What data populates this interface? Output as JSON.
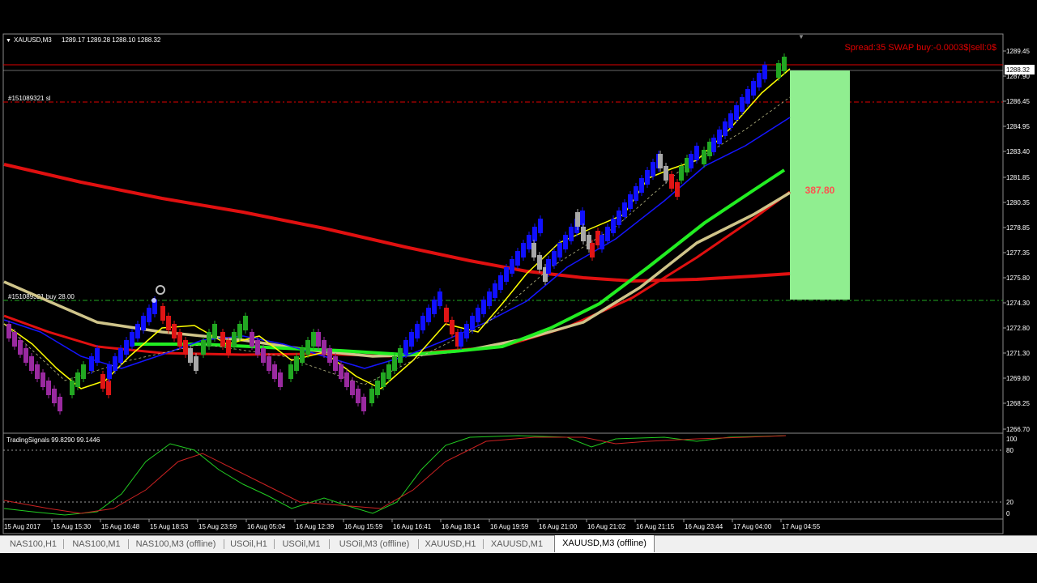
{
  "window": {
    "symbol_header": "XAUUSD,M3",
    "ohlc": "1289.17 1289.28 1288.10 1288.32",
    "info_line": "Spread:35   SWAP buy:-0.0003$|sell:0$"
  },
  "order_labels": {
    "stop_loss": "#151089321 sl",
    "entry": "#151089321 buy 28.00"
  },
  "profit_box_value": "387.80",
  "current_price_tag": "1288.32",
  "price_axis": [
    "1289.45",
    "1287.90",
    "1286.45",
    "1284.95",
    "1283.40",
    "1281.85",
    "1280.35",
    "1278.85",
    "1277.35",
    "1275.80",
    "1274.30",
    "1272.80",
    "1271.30",
    "1269.80",
    "1268.25",
    "1266.70"
  ],
  "indicator": {
    "title": "TradingSignals 99.8290 99.1446",
    "levels": [
      "100",
      "80",
      "20",
      "0"
    ]
  },
  "time_axis": [
    "15 Aug 2017",
    "15 Aug 15:30",
    "15 Aug 16:48",
    "15 Aug 18:53",
    "15 Aug 23:59",
    "16 Aug 05:04",
    "16 Aug 12:39",
    "16 Aug 15:59",
    "16 Aug 16:41",
    "16 Aug 18:14",
    "16 Aug 19:59",
    "16 Aug 21:00",
    "16 Aug 21:02",
    "16 Aug 21:15",
    "16 Aug 23:44",
    "17 Aug 04:00",
    "17 Aug 04:55"
  ],
  "tabs": [
    {
      "label": "NAS100,H1",
      "active": false
    },
    {
      "label": "NAS100,M1",
      "active": false
    },
    {
      "label": "NAS100,M3 (offline)",
      "active": false
    },
    {
      "label": "USOil,H1",
      "active": false
    },
    {
      "label": "USOil,M1",
      "active": false
    },
    {
      "label": "USOil,M3 (offline)",
      "active": false
    },
    {
      "label": "XAUUSD,H1",
      "active": false
    },
    {
      "label": "XAUUSD,M1",
      "active": false
    },
    {
      "label": "XAUUSD,M3 (offline)",
      "active": true
    }
  ],
  "colors": {
    "bull_brick": "#1010ff",
    "bull_flip": "#22a822",
    "bear_brick": "#9a2aa0",
    "bear_flip": "#e01515",
    "neutral_brick": "#a8a8a8",
    "slow_ma": "#e01010",
    "mid_ma": "#cfc48a",
    "fast_ma_green": "#22ee22",
    "ma_blue": "#1515ff",
    "ma_yellow": "#ffff00",
    "profit_box": "#90ee90",
    "profit_text": "#ff5050",
    "info_text": "#e00000"
  }
}
